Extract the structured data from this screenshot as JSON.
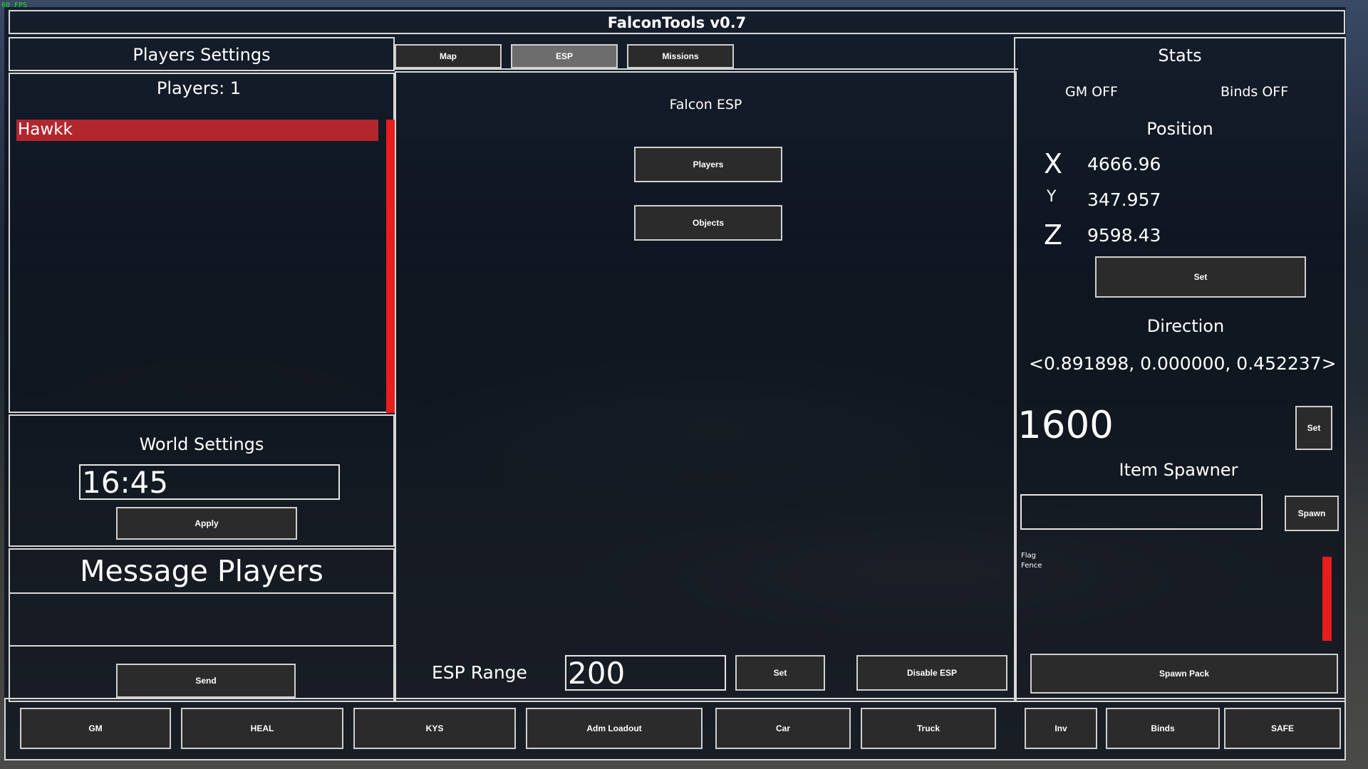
{
  "fps": "60 FPS",
  "title": "FalconTools v0.7",
  "colors": {
    "accent_red": "#e81d1d",
    "selected_row": "#b3262e",
    "active_tab": "#6d6d6d"
  },
  "players_panel": {
    "header": "Players Settings",
    "count_label": "Players: 1",
    "players": [
      "Hawkk"
    ]
  },
  "tabs": [
    {
      "label": "Map",
      "active": false
    },
    {
      "label": "ESP",
      "active": true
    },
    {
      "label": "Missions",
      "active": false
    }
  ],
  "esp": {
    "title": "Falcon ESP",
    "players_button": "Players",
    "objects_button": "Objects",
    "range_label": "ESP Range",
    "range_value": "200",
    "set_button": "Set",
    "disable_button": "Disable ESP"
  },
  "world": {
    "title": "World Settings",
    "time_value": "16:45",
    "apply_button": "Apply"
  },
  "message": {
    "title": "Message Players",
    "input_value": "",
    "send_button": "Send"
  },
  "stats": {
    "title": "Stats",
    "gm_status": "GM OFF",
    "binds_status": "Binds OFF",
    "position_title": "Position",
    "x_label": "X",
    "x_value": "4666.96",
    "y_label": "Y",
    "y_value": "347.957",
    "z_label": "Z",
    "z_value": "9598.43",
    "position_set_button": "Set",
    "direction_title": "Direction",
    "direction_value": "<0.891898, 0.000000, 0.452237>",
    "direction_input": "1600",
    "direction_set_button": "Set",
    "item_spawner_title": "Item Spawner",
    "item_input": "",
    "spawn_button": "Spawn",
    "items": [
      "Flag",
      "Fence"
    ],
    "spawn_pack_button": "Spawn Pack"
  },
  "bottom_bar": [
    "GM",
    "HEAL",
    "KYS",
    "Adm Loadout",
    "Car",
    "Truck",
    "Inv",
    "Binds",
    "SAFE"
  ]
}
